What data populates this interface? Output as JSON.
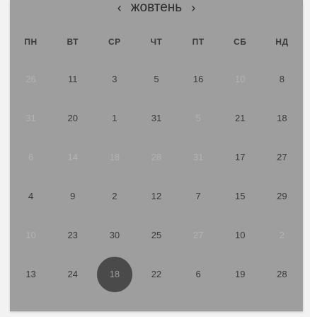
{
  "header": {
    "month_label": "жовтень",
    "prev_arrow": "‹",
    "next_arrow": "›"
  },
  "weekdays": [
    "ПН",
    "ВТ",
    "СР",
    "ЧТ",
    "ПТ",
    "СБ",
    "НД"
  ],
  "weeks": [
    [
      {
        "label": "26",
        "muted": true
      },
      {
        "label": "11",
        "muted": false
      },
      {
        "label": "3",
        "muted": false
      },
      {
        "label": "5",
        "muted": false
      },
      {
        "label": "16",
        "muted": false
      },
      {
        "label": "10",
        "muted": true
      },
      {
        "label": "8",
        "muted": false
      }
    ],
    [
      {
        "label": "31",
        "muted": true
      },
      {
        "label": "20",
        "muted": false
      },
      {
        "label": "1",
        "muted": false
      },
      {
        "label": "31",
        "muted": false
      },
      {
        "label": "5",
        "muted": true
      },
      {
        "label": "21",
        "muted": false
      },
      {
        "label": "18",
        "muted": false
      }
    ],
    [
      {
        "label": "6",
        "muted": true
      },
      {
        "label": "14",
        "muted": true
      },
      {
        "label": "18",
        "muted": true
      },
      {
        "label": "28",
        "muted": true
      },
      {
        "label": "31",
        "muted": true
      },
      {
        "label": "17",
        "muted": false
      },
      {
        "label": "27",
        "muted": false
      }
    ],
    [
      {
        "label": "4",
        "muted": false
      },
      {
        "label": "9",
        "muted": false
      },
      {
        "label": "2",
        "muted": false
      },
      {
        "label": "12",
        "muted": false
      },
      {
        "label": "7",
        "muted": false
      },
      {
        "label": "15",
        "muted": false
      },
      {
        "label": "29",
        "muted": false
      }
    ],
    [
      {
        "label": "10",
        "muted": true
      },
      {
        "label": "23",
        "muted": false
      },
      {
        "label": "30",
        "muted": false
      },
      {
        "label": "25",
        "muted": false
      },
      {
        "label": "27",
        "muted": true
      },
      {
        "label": "10",
        "muted": false
      },
      {
        "label": "2",
        "muted": true
      }
    ],
    [
      {
        "label": "13",
        "muted": false
      },
      {
        "label": "24",
        "muted": false
      },
      {
        "label": "18",
        "muted": false,
        "selected": true
      },
      {
        "label": "22",
        "muted": false
      },
      {
        "label": "6",
        "muted": false
      },
      {
        "label": "19",
        "muted": false
      },
      {
        "label": "28",
        "muted": false
      }
    ]
  ],
  "colors": {
    "panel_background": "#9e9e9e",
    "text": "#3a3a3a",
    "muted_text": "#b3b3b3",
    "selected_circle": "#4a4a4a"
  }
}
